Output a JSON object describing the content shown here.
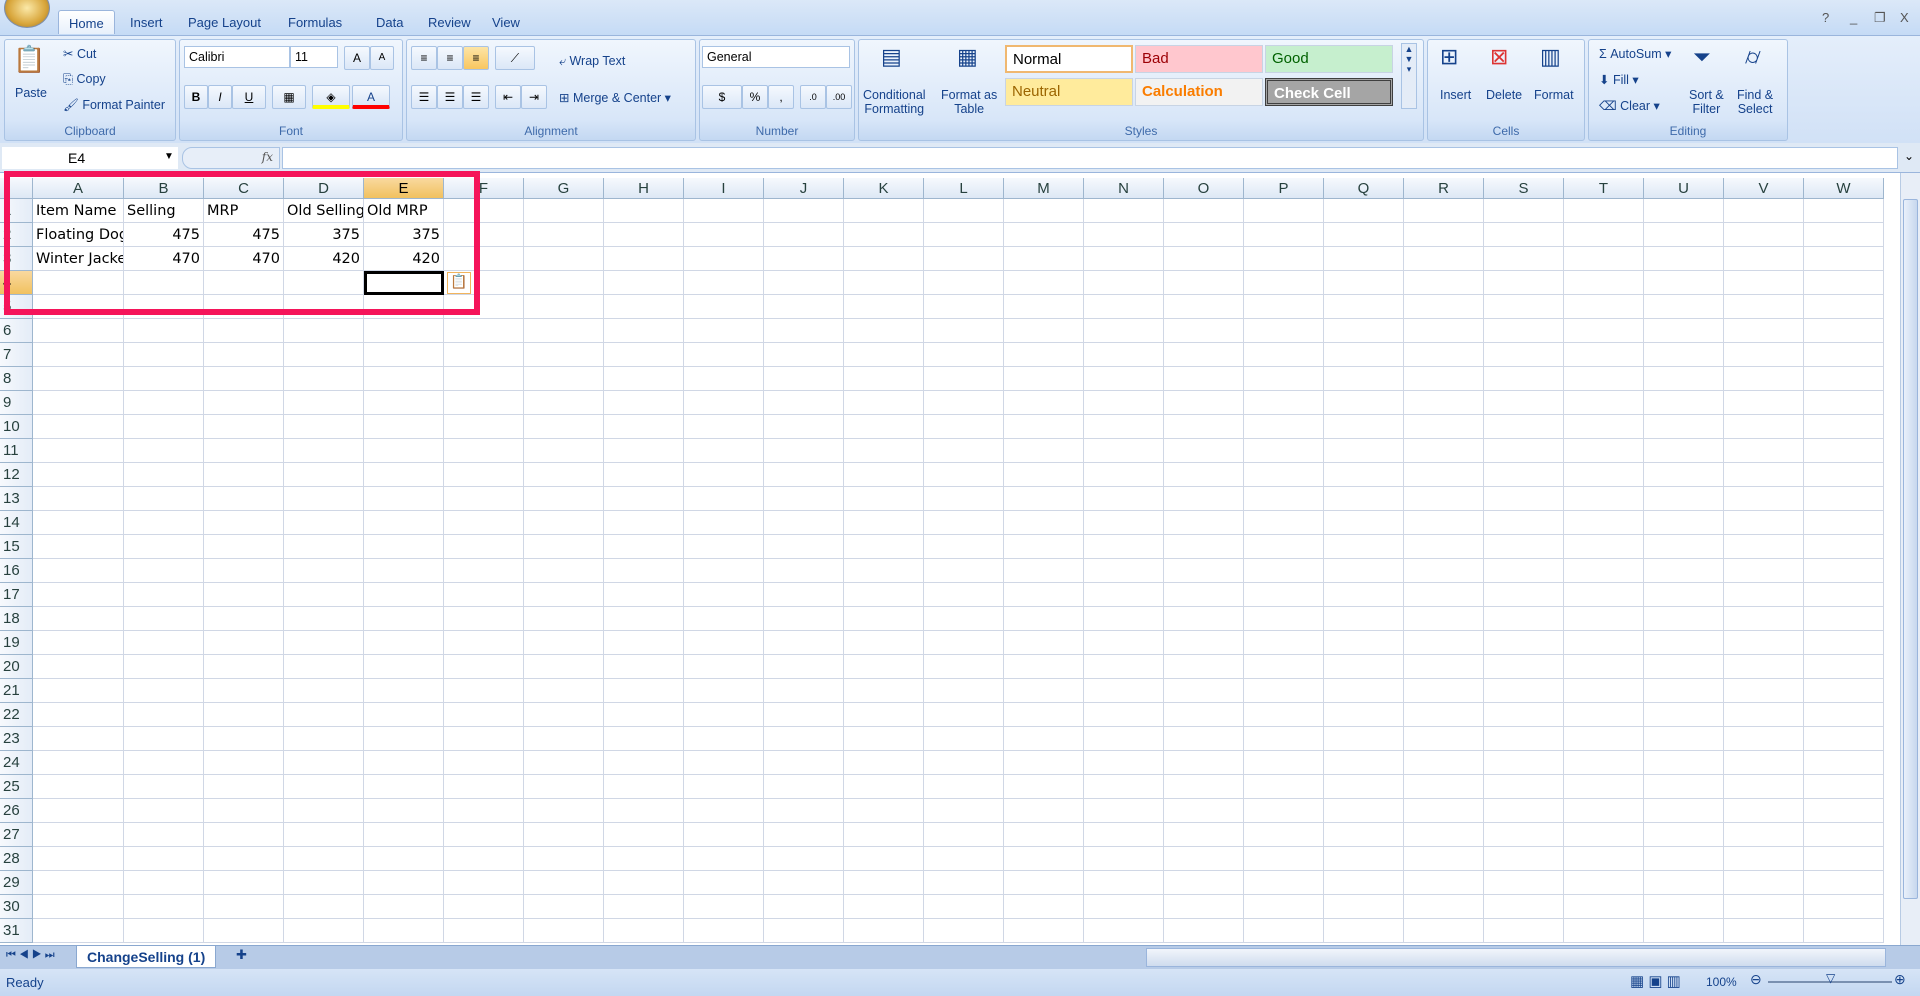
{
  "app": {
    "menu_tabs": [
      "Home",
      "Insert",
      "Page Layout",
      "Formulas",
      "Data",
      "Review",
      "View"
    ],
    "active_tab": "Home"
  },
  "ribbon": {
    "clipboard": {
      "label": "Clipboard",
      "paste": "Paste",
      "cut": "Cut",
      "copy": "Copy",
      "format_painter": "Format Painter"
    },
    "font": {
      "label": "Font",
      "font_name": "Calibri",
      "font_size": "11",
      "bold": "B",
      "italic": "I",
      "underline": "U",
      "fill_color": "#ffff00",
      "font_color": "#ff0000"
    },
    "alignment": {
      "label": "Alignment",
      "wrap_text": "Wrap Text",
      "merge_center": "Merge & Center"
    },
    "number": {
      "label": "Number",
      "format": "General",
      "percent": "%",
      "comma": ","
    },
    "styles": {
      "label": "Styles",
      "conditional": "Conditional",
      "conditional2": "Formatting",
      "format_table": "Format as",
      "format_table2": "Table",
      "cells": [
        {
          "name": "Normal",
          "bg": "#ffffff",
          "fg": "#000000"
        },
        {
          "name": "Bad",
          "bg": "#ffc7ce",
          "fg": "#9c0006"
        },
        {
          "name": "Good",
          "bg": "#c6efce",
          "fg": "#006100"
        },
        {
          "name": "Neutral",
          "bg": "#ffeb9c",
          "fg": "#9c6500"
        },
        {
          "name": "Calculation",
          "bg": "#f2f2f2",
          "fg": "#fa7d00"
        },
        {
          "name": "Check Cell",
          "bg": "#a5a5a5",
          "fg": "#ffffff"
        }
      ]
    },
    "cells": {
      "label": "Cells",
      "insert": "Insert",
      "delete": "Delete",
      "format": "Format"
    },
    "editing": {
      "label": "Editing",
      "autosum": "AutoSum",
      "fill": "Fill",
      "clear": "Clear",
      "sort": "Sort &",
      "sort2": "Filter",
      "find": "Find &",
      "find2": "Select"
    }
  },
  "formula_bar": {
    "name_box": "E4",
    "fx": "fx",
    "formula": ""
  },
  "sheet": {
    "columns": [
      "A",
      "B",
      "C",
      "D",
      "E",
      "F",
      "G",
      "H",
      "I",
      "J",
      "K",
      "L",
      "M",
      "N",
      "O",
      "P",
      "Q",
      "R",
      "S",
      "T",
      "U",
      "V",
      "W"
    ],
    "row_count": 31,
    "selected_cell": {
      "col": "E",
      "row": 4
    },
    "rows": [
      [
        "Item Name",
        "Selling",
        "MRP",
        "Old Selling",
        "Old MRP"
      ],
      [
        "Floating Dog",
        475,
        475,
        375,
        375
      ],
      [
        "Winter Jacket",
        470,
        470,
        420,
        420
      ]
    ]
  },
  "sheet_tabs": [
    "ChangeSelling (1)"
  ],
  "status": {
    "text": "Ready",
    "zoom": "100%"
  },
  "highlight_color": "#f5145a"
}
